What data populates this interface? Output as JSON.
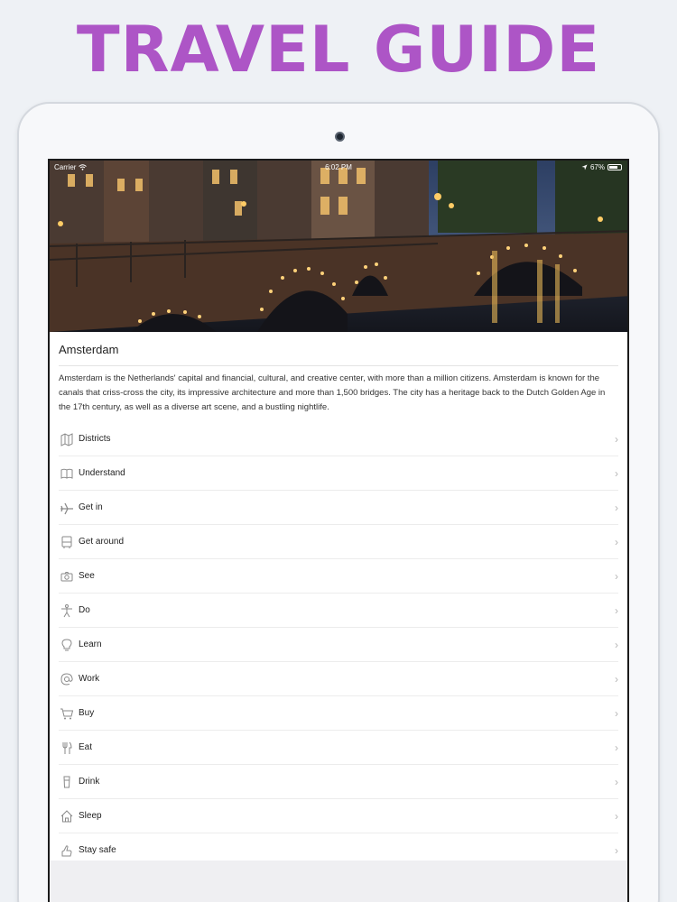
{
  "promo": {
    "headline": "TRAVEL GUIDE"
  },
  "status_bar": {
    "carrier": "Carrier",
    "time": "6:02 PM",
    "battery": "67%"
  },
  "city": {
    "name": "Amsterdam",
    "description": "Amsterdam is the Netherlands' capital and financial, cultural, and creative center, with more than a million citizens. Amsterdam is known for the canals that criss-cross the city, its impressive architecture and more than 1,500 bridges. The city has a heritage back to the Dutch Golden Age in the 17th century, as well as a diverse art scene, and a bustling nightlife."
  },
  "menu": [
    {
      "label": "Districts",
      "icon": "map-icon"
    },
    {
      "label": "Understand",
      "icon": "book-icon"
    },
    {
      "label": "Get in",
      "icon": "plane-icon"
    },
    {
      "label": "Get around",
      "icon": "bus-icon"
    },
    {
      "label": "See",
      "icon": "camera-icon"
    },
    {
      "label": "Do",
      "icon": "person-icon"
    },
    {
      "label": "Learn",
      "icon": "lightbulb-icon"
    },
    {
      "label": "Work",
      "icon": "at-icon"
    },
    {
      "label": "Buy",
      "icon": "cart-icon"
    },
    {
      "label": "Eat",
      "icon": "cutlery-icon"
    },
    {
      "label": "Drink",
      "icon": "glass-icon"
    },
    {
      "label": "Sleep",
      "icon": "house-icon"
    },
    {
      "label": "Stay safe",
      "icon": "hand-icon"
    }
  ],
  "colors": {
    "headline": "#ad55c6",
    "icon": "#8a8a8a",
    "chevron": "#b5b5b5"
  }
}
